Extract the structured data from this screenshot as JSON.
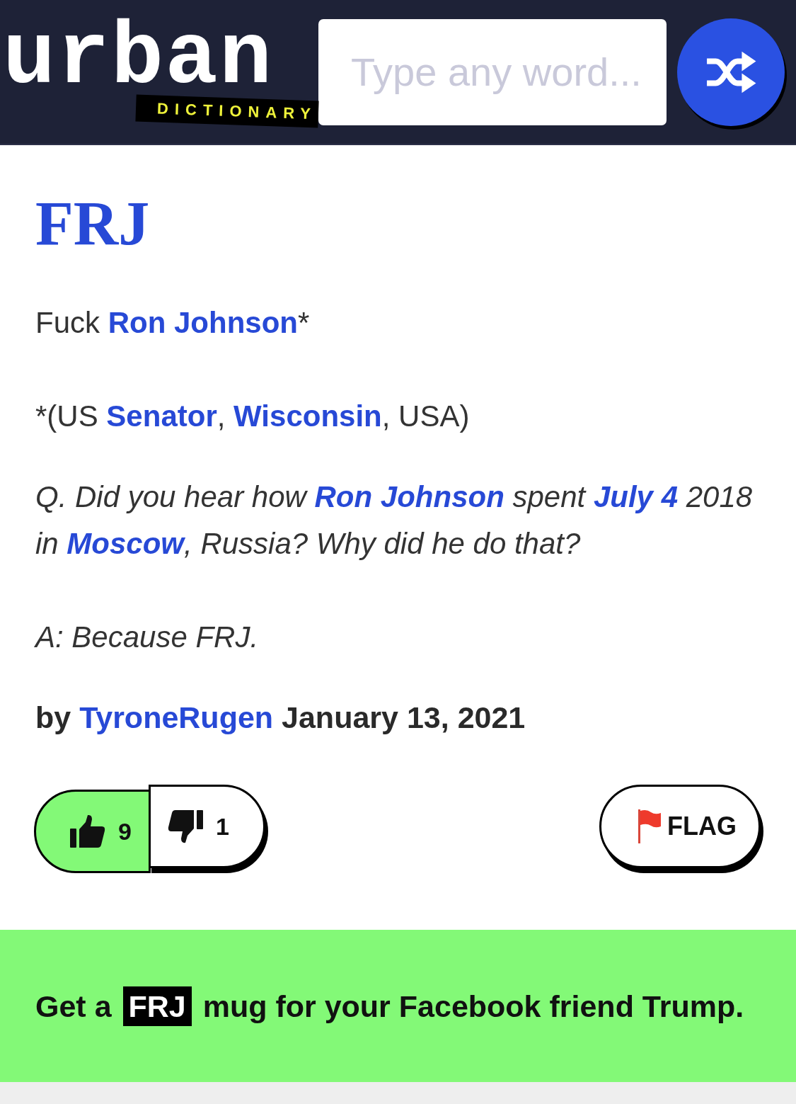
{
  "header": {
    "logo": {
      "word": "urban",
      "tagline": "DICTIONARY"
    },
    "search": {
      "placeholder": "Type any word..."
    }
  },
  "entry": {
    "word": "FRJ",
    "meaning": [
      {
        "lines": [
          [
            {
              "kind": "plain",
              "text": "Fuck "
            },
            {
              "kind": "link",
              "text": "Ron Johnson"
            },
            {
              "kind": "plain",
              "text": "*"
            }
          ]
        ]
      },
      {
        "lines": [
          [
            {
              "kind": "plain",
              "text": "*(US "
            },
            {
              "kind": "link",
              "text": "Senator"
            },
            {
              "kind": "plain",
              "text": ", "
            },
            {
              "kind": "link",
              "text": "Wisconsin"
            },
            {
              "kind": "plain",
              "text": ", USA)"
            }
          ]
        ]
      }
    ],
    "example": [
      {
        "lines": [
          [
            {
              "kind": "plain",
              "text": "Q. Did you hear how "
            },
            {
              "kind": "link",
              "text": "Ron Johnson"
            },
            {
              "kind": "plain",
              "text": " spent "
            },
            {
              "kind": "link",
              "text": "July 4"
            },
            {
              "kind": "plain",
              "text": " 2018"
            }
          ],
          [
            {
              "kind": "plain",
              "text": "in "
            },
            {
              "kind": "link",
              "text": "Moscow"
            },
            {
              "kind": "plain",
              "text": ", Russia? Why did he do that?"
            }
          ]
        ]
      },
      {
        "lines": [
          [
            {
              "kind": "plain",
              "text": "A: Because FRJ."
            }
          ]
        ]
      }
    ],
    "byline": {
      "prefix": "by",
      "author": "TyroneRugen",
      "date": "January 13, 2021"
    },
    "votes": [
      {
        "kind": "up",
        "count": "9",
        "selected": true
      },
      {
        "kind": "down",
        "count": "1",
        "selected": false
      }
    ],
    "flag": {
      "label": "FLAG"
    }
  },
  "promo": {
    "segments": [
      {
        "kind": "plain",
        "text": "Get a "
      },
      {
        "kind": "highlight",
        "text": "FRJ"
      },
      {
        "kind": "plain",
        "text": " mug for your Facebook friend Trump."
      }
    ]
  }
}
